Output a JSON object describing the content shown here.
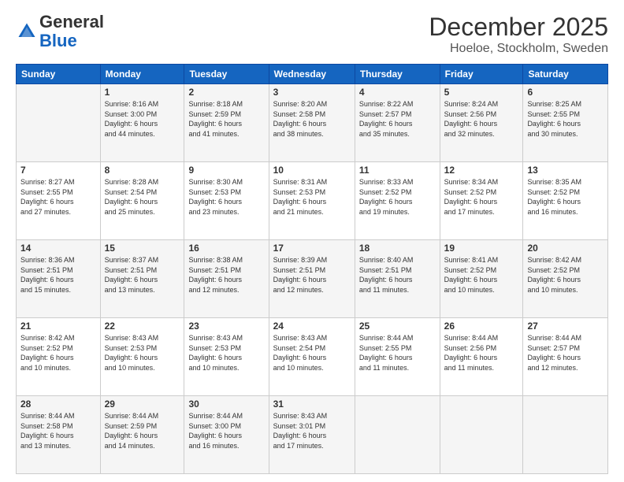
{
  "header": {
    "logo_line1": "General",
    "logo_line2": "Blue",
    "month_title": "December 2025",
    "location": "Hoeloe, Stockholm, Sweden"
  },
  "days_of_week": [
    "Sunday",
    "Monday",
    "Tuesday",
    "Wednesday",
    "Thursday",
    "Friday",
    "Saturday"
  ],
  "weeks": [
    [
      {
        "day": "",
        "info": ""
      },
      {
        "day": "1",
        "info": "Sunrise: 8:16 AM\nSunset: 3:00 PM\nDaylight: 6 hours\nand 44 minutes."
      },
      {
        "day": "2",
        "info": "Sunrise: 8:18 AM\nSunset: 2:59 PM\nDaylight: 6 hours\nand 41 minutes."
      },
      {
        "day": "3",
        "info": "Sunrise: 8:20 AM\nSunset: 2:58 PM\nDaylight: 6 hours\nand 38 minutes."
      },
      {
        "day": "4",
        "info": "Sunrise: 8:22 AM\nSunset: 2:57 PM\nDaylight: 6 hours\nand 35 minutes."
      },
      {
        "day": "5",
        "info": "Sunrise: 8:24 AM\nSunset: 2:56 PM\nDaylight: 6 hours\nand 32 minutes."
      },
      {
        "day": "6",
        "info": "Sunrise: 8:25 AM\nSunset: 2:55 PM\nDaylight: 6 hours\nand 30 minutes."
      }
    ],
    [
      {
        "day": "7",
        "info": "Sunrise: 8:27 AM\nSunset: 2:55 PM\nDaylight: 6 hours\nand 27 minutes."
      },
      {
        "day": "8",
        "info": "Sunrise: 8:28 AM\nSunset: 2:54 PM\nDaylight: 6 hours\nand 25 minutes."
      },
      {
        "day": "9",
        "info": "Sunrise: 8:30 AM\nSunset: 2:53 PM\nDaylight: 6 hours\nand 23 minutes."
      },
      {
        "day": "10",
        "info": "Sunrise: 8:31 AM\nSunset: 2:53 PM\nDaylight: 6 hours\nand 21 minutes."
      },
      {
        "day": "11",
        "info": "Sunrise: 8:33 AM\nSunset: 2:52 PM\nDaylight: 6 hours\nand 19 minutes."
      },
      {
        "day": "12",
        "info": "Sunrise: 8:34 AM\nSunset: 2:52 PM\nDaylight: 6 hours\nand 17 minutes."
      },
      {
        "day": "13",
        "info": "Sunrise: 8:35 AM\nSunset: 2:52 PM\nDaylight: 6 hours\nand 16 minutes."
      }
    ],
    [
      {
        "day": "14",
        "info": "Sunrise: 8:36 AM\nSunset: 2:51 PM\nDaylight: 6 hours\nand 15 minutes."
      },
      {
        "day": "15",
        "info": "Sunrise: 8:37 AM\nSunset: 2:51 PM\nDaylight: 6 hours\nand 13 minutes."
      },
      {
        "day": "16",
        "info": "Sunrise: 8:38 AM\nSunset: 2:51 PM\nDaylight: 6 hours\nand 12 minutes."
      },
      {
        "day": "17",
        "info": "Sunrise: 8:39 AM\nSunset: 2:51 PM\nDaylight: 6 hours\nand 12 minutes."
      },
      {
        "day": "18",
        "info": "Sunrise: 8:40 AM\nSunset: 2:51 PM\nDaylight: 6 hours\nand 11 minutes."
      },
      {
        "day": "19",
        "info": "Sunrise: 8:41 AM\nSunset: 2:52 PM\nDaylight: 6 hours\nand 10 minutes."
      },
      {
        "day": "20",
        "info": "Sunrise: 8:42 AM\nSunset: 2:52 PM\nDaylight: 6 hours\nand 10 minutes."
      }
    ],
    [
      {
        "day": "21",
        "info": "Sunrise: 8:42 AM\nSunset: 2:52 PM\nDaylight: 6 hours\nand 10 minutes."
      },
      {
        "day": "22",
        "info": "Sunrise: 8:43 AM\nSunset: 2:53 PM\nDaylight: 6 hours\nand 10 minutes."
      },
      {
        "day": "23",
        "info": "Sunrise: 8:43 AM\nSunset: 2:53 PM\nDaylight: 6 hours\nand 10 minutes."
      },
      {
        "day": "24",
        "info": "Sunrise: 8:43 AM\nSunset: 2:54 PM\nDaylight: 6 hours\nand 10 minutes."
      },
      {
        "day": "25",
        "info": "Sunrise: 8:44 AM\nSunset: 2:55 PM\nDaylight: 6 hours\nand 11 minutes."
      },
      {
        "day": "26",
        "info": "Sunrise: 8:44 AM\nSunset: 2:56 PM\nDaylight: 6 hours\nand 11 minutes."
      },
      {
        "day": "27",
        "info": "Sunrise: 8:44 AM\nSunset: 2:57 PM\nDaylight: 6 hours\nand 12 minutes."
      }
    ],
    [
      {
        "day": "28",
        "info": "Sunrise: 8:44 AM\nSunset: 2:58 PM\nDaylight: 6 hours\nand 13 minutes."
      },
      {
        "day": "29",
        "info": "Sunrise: 8:44 AM\nSunset: 2:59 PM\nDaylight: 6 hours\nand 14 minutes."
      },
      {
        "day": "30",
        "info": "Sunrise: 8:44 AM\nSunset: 3:00 PM\nDaylight: 6 hours\nand 16 minutes."
      },
      {
        "day": "31",
        "info": "Sunrise: 8:43 AM\nSunset: 3:01 PM\nDaylight: 6 hours\nand 17 minutes."
      },
      {
        "day": "",
        "info": ""
      },
      {
        "day": "",
        "info": ""
      },
      {
        "day": "",
        "info": ""
      }
    ]
  ]
}
